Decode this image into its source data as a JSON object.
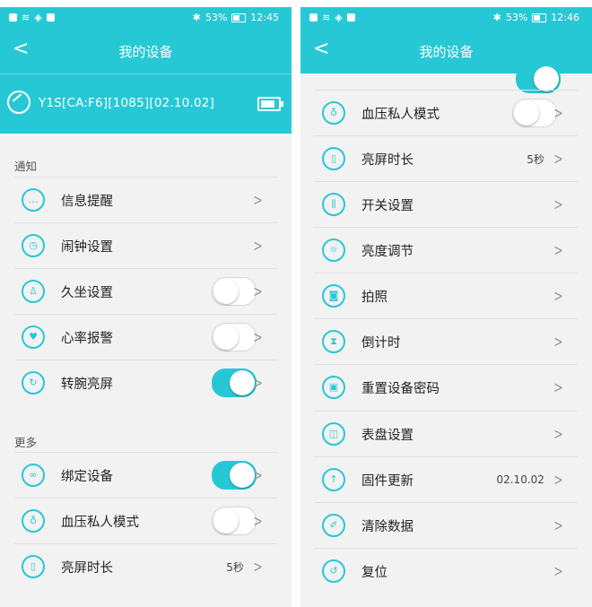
{
  "accent": "#27c8d6",
  "left": {
    "status": {
      "battery": "53%",
      "time": "12:45"
    },
    "title": "我的设备",
    "device_name": "Y1S[CA:F6][1085][02.10.02]",
    "section_notify": "通知",
    "section_more": "更多",
    "rows": [
      {
        "label": "信息提醒",
        "icon": "message-icon"
      },
      {
        "label": "闹钟设置",
        "icon": "alarm-clock-icon"
      },
      {
        "label": "久坐设置",
        "icon": "sedentary-icon",
        "toggle": false
      },
      {
        "label": "心率报警",
        "icon": "heart-rate-icon",
        "toggle": false
      },
      {
        "label": "转腕亮屏",
        "icon": "wrist-turn-icon",
        "toggle": true
      },
      {
        "label": "绑定设备",
        "icon": "link-icon",
        "toggle": true
      },
      {
        "label": "血压私人模式",
        "icon": "blood-pressure-icon",
        "toggle": false
      },
      {
        "label": "亮屏时长",
        "icon": "screen-duration-icon",
        "value": "5秒"
      }
    ]
  },
  "right": {
    "status": {
      "battery": "53%",
      "time": "12:46"
    },
    "title": "我的设备",
    "rows": [
      {
        "label": "血压私人模式",
        "icon": "blood-pressure-icon",
        "toggle": false
      },
      {
        "label": "亮屏时长",
        "icon": "screen-duration-icon",
        "value": "5秒"
      },
      {
        "label": "开关设置",
        "icon": "sliders-icon"
      },
      {
        "label": "亮度调节",
        "icon": "brightness-icon"
      },
      {
        "label": "拍照",
        "icon": "camera-icon"
      },
      {
        "label": "倒计时",
        "icon": "hourglass-icon"
      },
      {
        "label": "重置设备密码",
        "icon": "lock-icon"
      },
      {
        "label": "表盘设置",
        "icon": "watch-face-icon"
      },
      {
        "label": "固件更新",
        "icon": "upload-icon",
        "value": "02.10.02"
      },
      {
        "label": "清除数据",
        "icon": "eraser-icon"
      },
      {
        "label": "复位",
        "icon": "reset-icon"
      }
    ]
  }
}
